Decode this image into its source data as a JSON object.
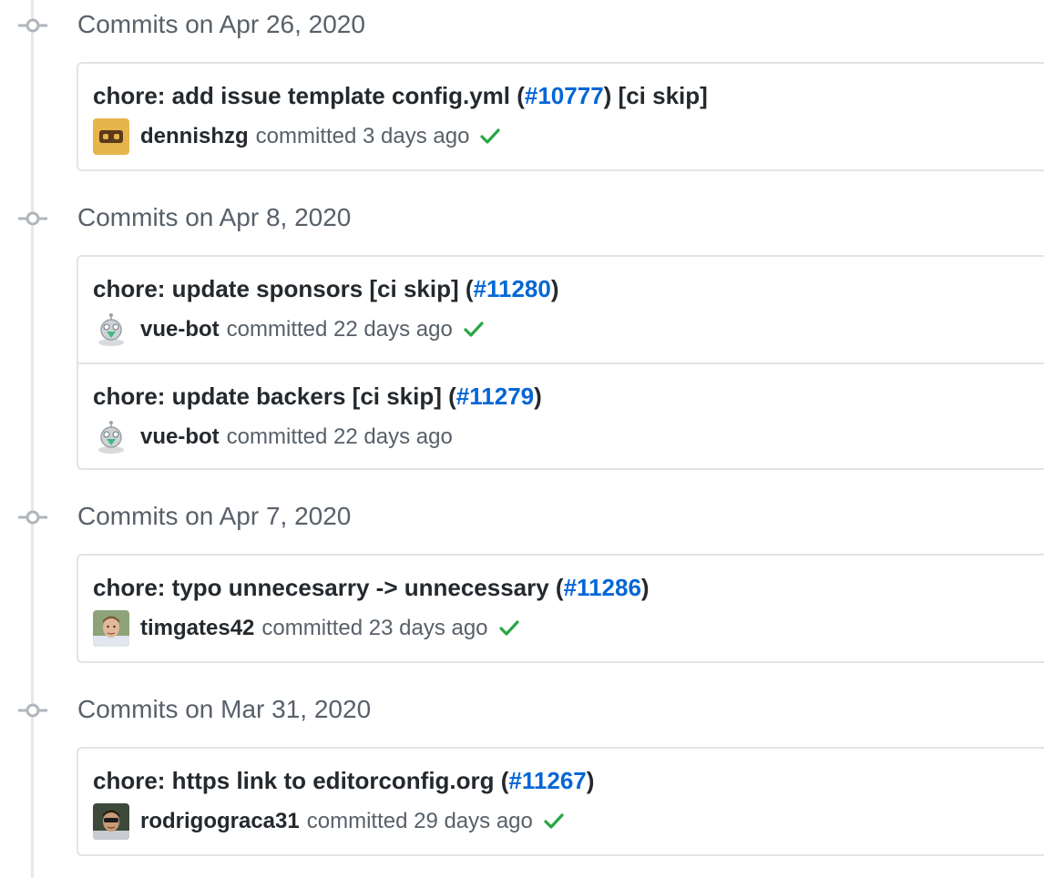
{
  "groups": [
    {
      "title": "Commits on Apr 26, 2020",
      "commits": [
        {
          "msg_pre": "chore: add issue template config.yml (",
          "msg_link": "#10777",
          "msg_post": ") [ci skip]",
          "author": "dennishzg",
          "committed": "committed 3 days ago",
          "avatar": "dennishzg-avatar",
          "status": "success-check"
        }
      ]
    },
    {
      "title": "Commits on Apr 8, 2020",
      "commits": [
        {
          "msg_pre": "chore: update sponsors [ci skip] (",
          "msg_link": "#11280",
          "msg_post": ")",
          "author": "vue-bot",
          "committed": "committed 22 days ago",
          "avatar": "vue-bot-avatar",
          "status": "success-check"
        },
        {
          "msg_pre": "chore: update backers [ci skip] (",
          "msg_link": "#11279",
          "msg_post": ")",
          "author": "vue-bot",
          "committed": "committed 22 days ago",
          "avatar": "vue-bot-avatar",
          "status": "none"
        }
      ]
    },
    {
      "title": "Commits on Apr 7, 2020",
      "commits": [
        {
          "msg_pre": "chore: typo unnecesarry -> unnecessary (",
          "msg_link": "#11286",
          "msg_post": ")",
          "author": "timgates42",
          "committed": "committed 23 days ago",
          "avatar": "timgates42-avatar",
          "status": "success-check"
        }
      ]
    },
    {
      "title": "Commits on Mar 31, 2020",
      "commits": [
        {
          "msg_pre": "chore: https link to editorconfig.org (",
          "msg_link": "#11267",
          "msg_post": ")",
          "author": "rodrigograca31",
          "committed": "committed 29 days ago",
          "avatar": "rodrigograca31-avatar",
          "status": "success-check"
        }
      ]
    }
  ],
  "colors": {
    "link": "#0366d6",
    "check": "#28a745",
    "muted": "#586069",
    "border": "#e1e4e8"
  }
}
